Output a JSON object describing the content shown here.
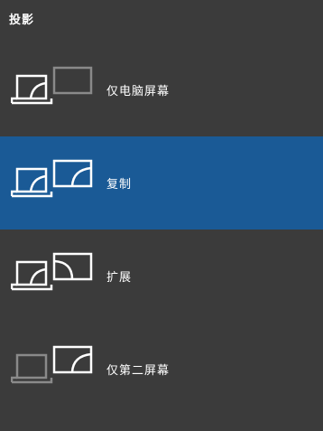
{
  "panel": {
    "title": "投影",
    "options": [
      {
        "label": "仅电脑屏幕",
        "icon": "pc-screen-only-icon",
        "selected": false
      },
      {
        "label": "复制",
        "icon": "duplicate-icon",
        "selected": true
      },
      {
        "label": "扩展",
        "icon": "extend-icon",
        "selected": false
      },
      {
        "label": "仅第二屏幕",
        "icon": "second-screen-only-icon",
        "selected": false
      }
    ]
  },
  "colors": {
    "background": "#3b3b3b",
    "selected": "#1a5a96",
    "active_stroke": "#ffffff",
    "inactive_stroke": "#8a8a8a"
  }
}
